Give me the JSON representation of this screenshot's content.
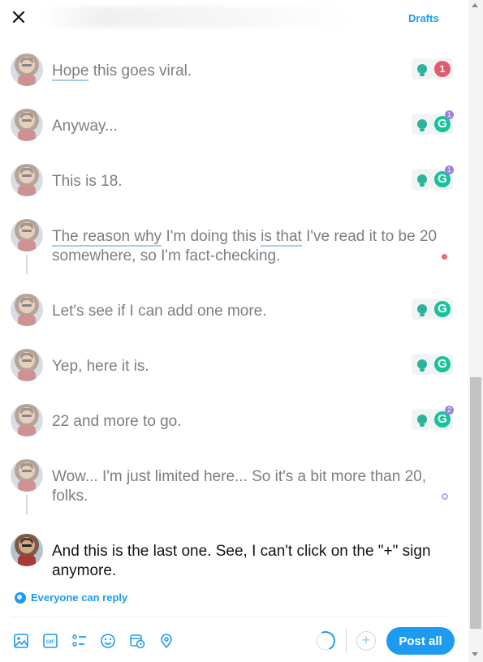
{
  "header": {
    "drafts_label": "Drafts"
  },
  "tweets": [
    {
      "text_parts": [
        "Hope",
        " this goes viral."
      ],
      "grammarly_count": "1"
    },
    {
      "text": "Anyway...",
      "grammarly_count": "1"
    },
    {
      "text": "This is 18.",
      "grammarly_count": "1"
    },
    {
      "text_parts": [
        "The reason why",
        " I'm doing this ",
        "is that",
        " I've read it to be 20 somewhere, so I'm fact-checking."
      ]
    },
    {
      "text": "Let's see if I can add one more."
    },
    {
      "text": "Yep, here it is."
    },
    {
      "text": "22 and more to go.",
      "grammarly_count": "2"
    },
    {
      "text": "Wow... I'm just limited here... So it's a bit more than 20, folks."
    },
    {
      "text": "And this is the last one. See, I can't click on the \"+\" sign anymore."
    }
  ],
  "reply_setting": "Everyone can reply",
  "footer": {
    "add_symbol": "+",
    "post_all_label": "Post all"
  },
  "colors": {
    "accent": "#1d9bf0",
    "grammarly_green": "#15c39a",
    "error_red": "#e05b6f"
  }
}
